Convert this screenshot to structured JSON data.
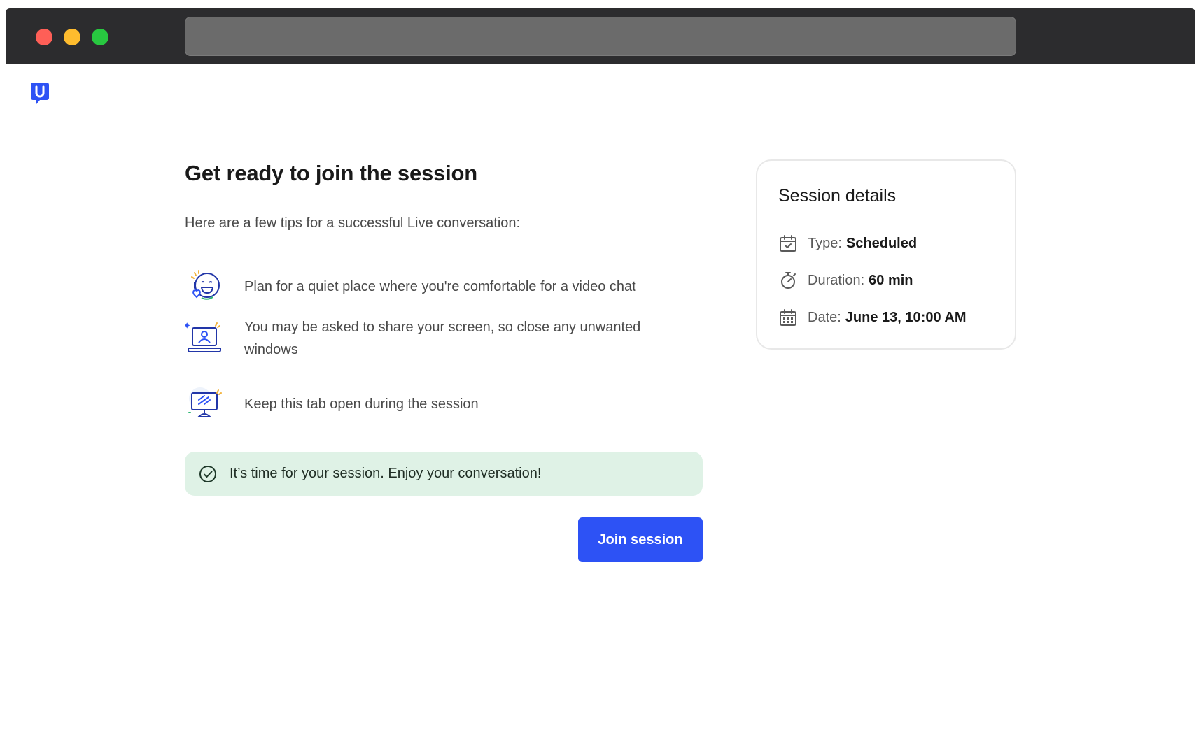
{
  "browser": {
    "url": ""
  },
  "header": {
    "logo_icon": "usertesting-u-logo-icon",
    "brand_color": "#2d52f5"
  },
  "main": {
    "title": "Get ready to join the session",
    "intro": "Here are a few tips for a successful Live conversation:",
    "tips": [
      {
        "icon": "smiley-heart-icon",
        "text": "Plan for a quiet place where you're comfortable for a video chat"
      },
      {
        "icon": "laptop-person-icon",
        "text": "You may be asked to share your screen, so close any unwanted windows"
      },
      {
        "icon": "monitor-icon",
        "text": "Keep this tab open during the session"
      }
    ],
    "notice": {
      "icon": "check-circle-icon",
      "text": "It’s time for your session. Enjoy your conversation!",
      "color": "#dff2e6"
    },
    "join_button": "Join session"
  },
  "details": {
    "title": "Session details",
    "type_label": "Type:",
    "type_value": "Scheduled",
    "duration_label": "Duration:",
    "duration_value": "60 min",
    "date_label": "Date:",
    "date_value": "June 13, 10:00 AM"
  }
}
